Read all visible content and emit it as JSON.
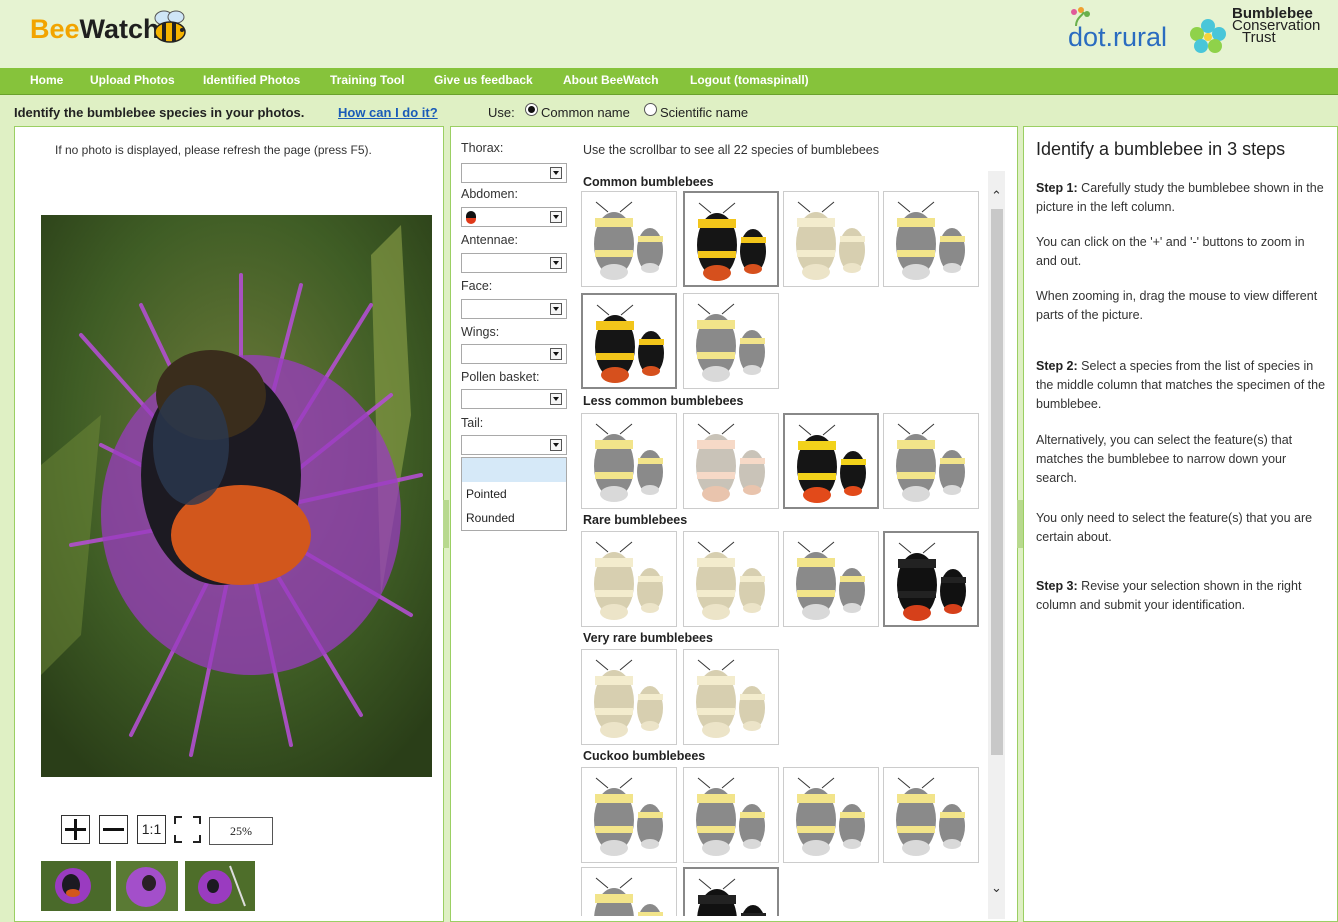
{
  "app": {
    "logo_bee": "Bee",
    "logo_watch": "Watch",
    "partner1": "dot.rural",
    "partner2_line1": "Bumblebee",
    "partner2_line2": "Conservation",
    "partner2_line3": "Trust"
  },
  "nav": {
    "items": [
      {
        "label": "Home"
      },
      {
        "label": "Upload Photos"
      },
      {
        "label": "Identified Photos"
      },
      {
        "label": "Training Tool"
      },
      {
        "label": "Give us feedback"
      },
      {
        "label": "About BeeWatch"
      },
      {
        "label": "Logout (tomaspinall)"
      }
    ]
  },
  "toolbar": {
    "prompt": "Identify the bumblebee species in your photos.",
    "help_link": "How can I do it?",
    "use_label": "Use:",
    "option_common": "Common name",
    "option_scientific": "Scientific name",
    "selected": "Common name"
  },
  "left": {
    "notice": "If no photo is displayed, please refresh the page (press F5).",
    "zoom_in": "+",
    "zoom_out": "—",
    "zoom_actual": "1:1",
    "zoom_level": "25%"
  },
  "features": {
    "thorax": "Thorax:",
    "abdomen": "Abdomen:",
    "antennae": "Antennae:",
    "face": "Face:",
    "wings": "Wings:",
    "pollen": "Pollen basket:",
    "tail": "Tail:",
    "tail_options": [
      "",
      "Pointed",
      "Rounded"
    ]
  },
  "gallery": {
    "note": "Use the scrollbar to see all 22 species of bumblebees",
    "categories": [
      {
        "label": "Common bumblebees"
      },
      {
        "label": "Less common bumblebees"
      },
      {
        "label": "Rare bumblebees"
      },
      {
        "label": "Very rare bumblebees"
      },
      {
        "label": "Cuckoo bumblebees"
      }
    ]
  },
  "right": {
    "title": "Identify a bumblebee in 3 steps",
    "step1_label": "Step 1:",
    "step1_text": "Carefully study the bumblebee shown in the picture in the left column.",
    "step1b": "You can click on the '+' and '-' buttons to zoom in and out.",
    "step1c": "When zooming in, drag the mouse to view different parts of the picture.",
    "step2_label": "Step 2:",
    "step2_text": "Select a species from the list of species in the middle column that matches the specimen of the bumblebee.",
    "step2b": "Alternatively, you can select the feature(s) that matches the bumblebee to narrow down your search.",
    "step2c": "You only need to select the feature(s) that you are certain about.",
    "step3_label": "Step 3:",
    "step3_text": "Revise your selection shown in the right column and submit your identification."
  },
  "colors": {
    "nav_green": "#86c33b",
    "page_green": "#dff0c4",
    "link_blue": "#1a5bb8"
  }
}
